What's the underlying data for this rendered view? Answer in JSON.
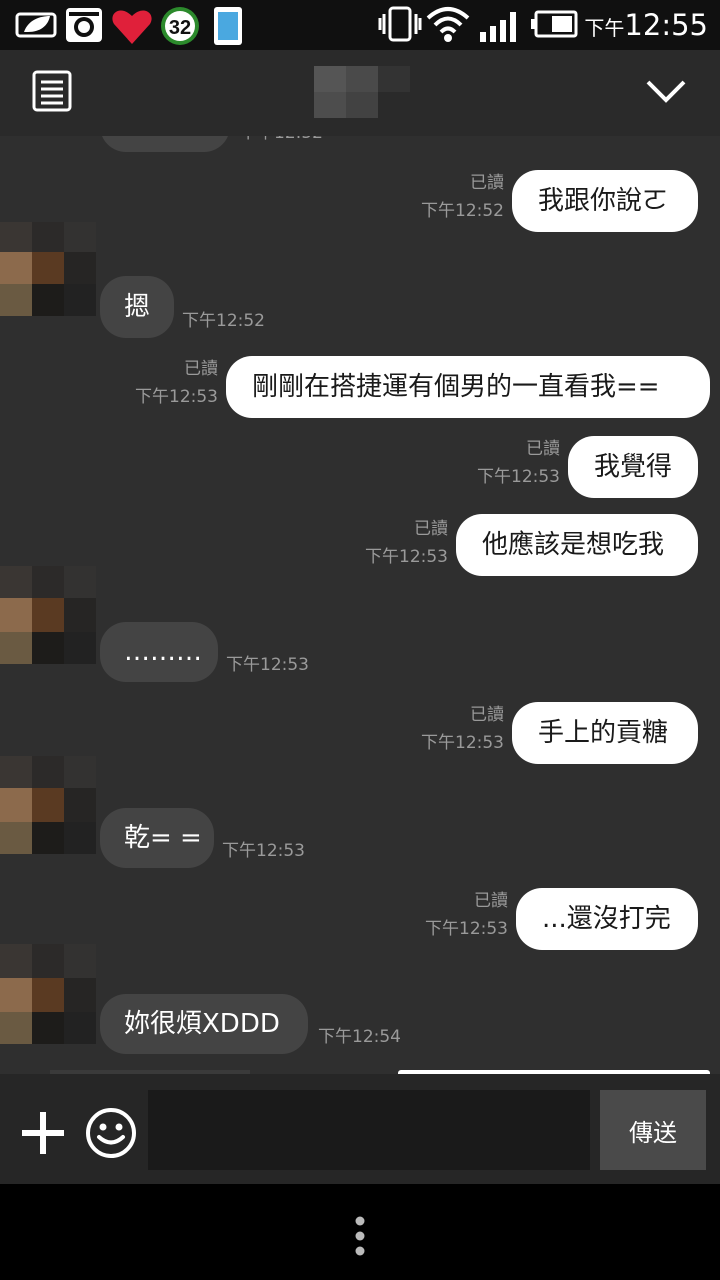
{
  "status_bar": {
    "time_ampm": "下午",
    "time": "12:55",
    "badge_count": "32",
    "icons": [
      "leaf-notification-icon",
      "instagram-icon",
      "heart-icon",
      "badge-counter-icon",
      "phone-icon",
      "vibrate-icon",
      "wifi-icon",
      "signal-icon",
      "battery-icon"
    ]
  },
  "header": {
    "menu_icon": "list-icon",
    "collapse_icon": "chevron-down-icon"
  },
  "chat": {
    "top_partial_time": "下午12:52",
    "messages": [
      {
        "dir": "out",
        "text": "我跟你說ㄛ",
        "read": "已讀",
        "time": "下午12:52"
      },
      {
        "dir": "in",
        "text": "摁",
        "time": "下午12:52"
      },
      {
        "dir": "out",
        "text": "剛剛在搭捷運有個男的一直看我==",
        "read": "已讀",
        "time": "下午12:53"
      },
      {
        "dir": "out",
        "text": "我覺得",
        "read": "已讀",
        "time": "下午12:53"
      },
      {
        "dir": "out",
        "text": "他應該是想吃我",
        "read": "已讀",
        "time": "下午12:53"
      },
      {
        "dir": "in",
        "text": "………",
        "time": "下午12:53"
      },
      {
        "dir": "out",
        "text": "手上的貢糖",
        "read": "已讀",
        "time": "下午12:53"
      },
      {
        "dir": "in",
        "text": "乾= =",
        "time": "下午12:53"
      },
      {
        "dir": "out",
        "text": "...還沒打完",
        "read": "已讀",
        "time": "下午12:53"
      },
      {
        "dir": "in",
        "text": "妳很煩XDDD",
        "time": "下午12:54"
      }
    ]
  },
  "input_bar": {
    "placeholder": "",
    "send_label": "傳送"
  },
  "colors": {
    "chat_bg": "#2f2f2f",
    "outgoing_bubble": "#ffffff",
    "incoming_bubble": "#444444",
    "meta_text": "#9a9a9a"
  }
}
